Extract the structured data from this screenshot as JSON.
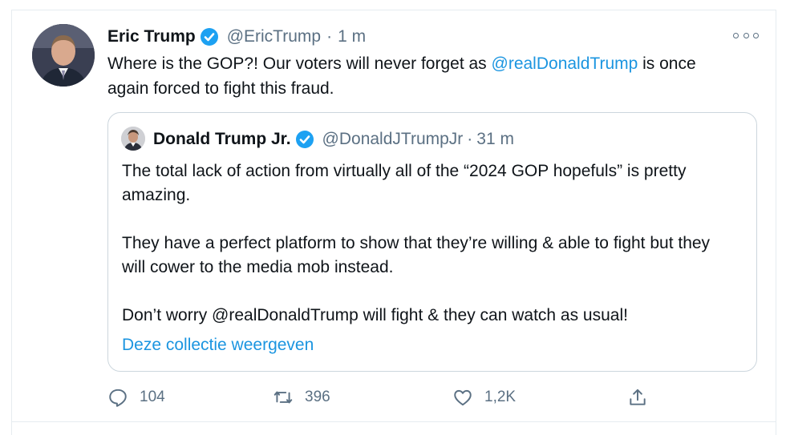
{
  "tweet": {
    "author_name": "Eric Trump",
    "author_handle": "@EricTrump",
    "separator": "·",
    "time": "1 m",
    "text_before": "Where is the GOP?! Our voters will never forget as ",
    "mention": "@realDonaldTrump",
    "text_after": " is once again forced to fight this fraud.",
    "icons": {
      "verified": "verified-badge-icon",
      "more": "more-options-icon"
    }
  },
  "quote": {
    "author_name": "Donald Trump Jr.",
    "author_handle": "@DonaldJTrumpJr",
    "separator": "·",
    "time": "31 m",
    "paragraph1": "The total lack of action from virtually all of the “2024 GOP hopefuls” is pretty amazing.",
    "paragraph2": "They have a perfect platform to show that they’re willing & able to fight but they will cower to the media mob instead.",
    "paragraph3": "Don’t worry @realDonaldTrump will fight & they can watch as usual!",
    "show_more": "Deze collectie weergeven"
  },
  "actions": {
    "reply_count": "104",
    "retweet_count": "396",
    "like_count": "1,2K",
    "icons": [
      "reply-icon",
      "retweet-icon",
      "like-icon",
      "share-icon"
    ]
  },
  "colors": {
    "link": "#1b95e0",
    "secondary_text": "#5b7083",
    "border": "#ccd6dd",
    "verified": "#1da1f2"
  }
}
